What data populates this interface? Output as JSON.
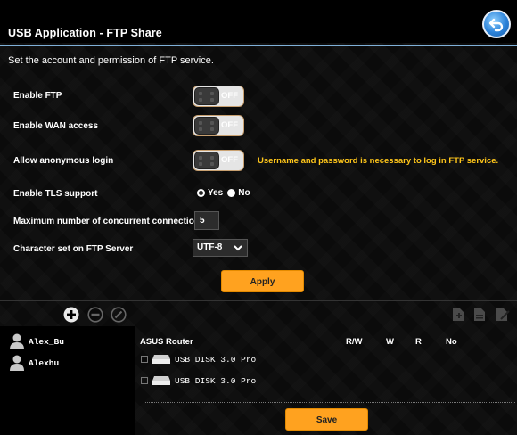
{
  "header": {
    "title": "USB Application - FTP Share",
    "back_icon": "back-arrow-icon",
    "subtitle": "Set the account and permission of FTP service."
  },
  "settings": {
    "enable_ftp": {
      "label": "Enable FTP",
      "state": "OFF"
    },
    "enable_wan": {
      "label": "Enable WAN access",
      "state": "OFF"
    },
    "anonymous": {
      "label": "Allow anonymous login",
      "state": "OFF",
      "note": "Username and password is necessary to log in FTP service."
    },
    "tls": {
      "label": "Enable TLS support",
      "yes": "Yes",
      "no": "No",
      "selected": "Yes"
    },
    "max_conn": {
      "label": "Maximum number of concurrent connections",
      "value": "5"
    },
    "charset": {
      "label": "Character set on FTP Server",
      "value": "UTF-8"
    },
    "apply_label": "Apply"
  },
  "toolbar": {
    "add_icon": "add-circle-icon",
    "remove_icon": "remove-circle-icon",
    "edit_icon": "edit-circle-icon"
  },
  "accounts": [
    "Alex_Bu",
    "Alexhu"
  ],
  "permissions": {
    "router_label": "ASUS Router",
    "columns": [
      "R/W",
      "W",
      "R",
      "No"
    ],
    "disks": [
      "USB DISK 3.0 Pro",
      "USB DISK 3.0 Pro"
    ],
    "save_label": "Save"
  },
  "colors": {
    "accent_orange": "#ffa21f",
    "warning_text": "#ffc61a",
    "rule_blue": "#7fb0d8"
  }
}
